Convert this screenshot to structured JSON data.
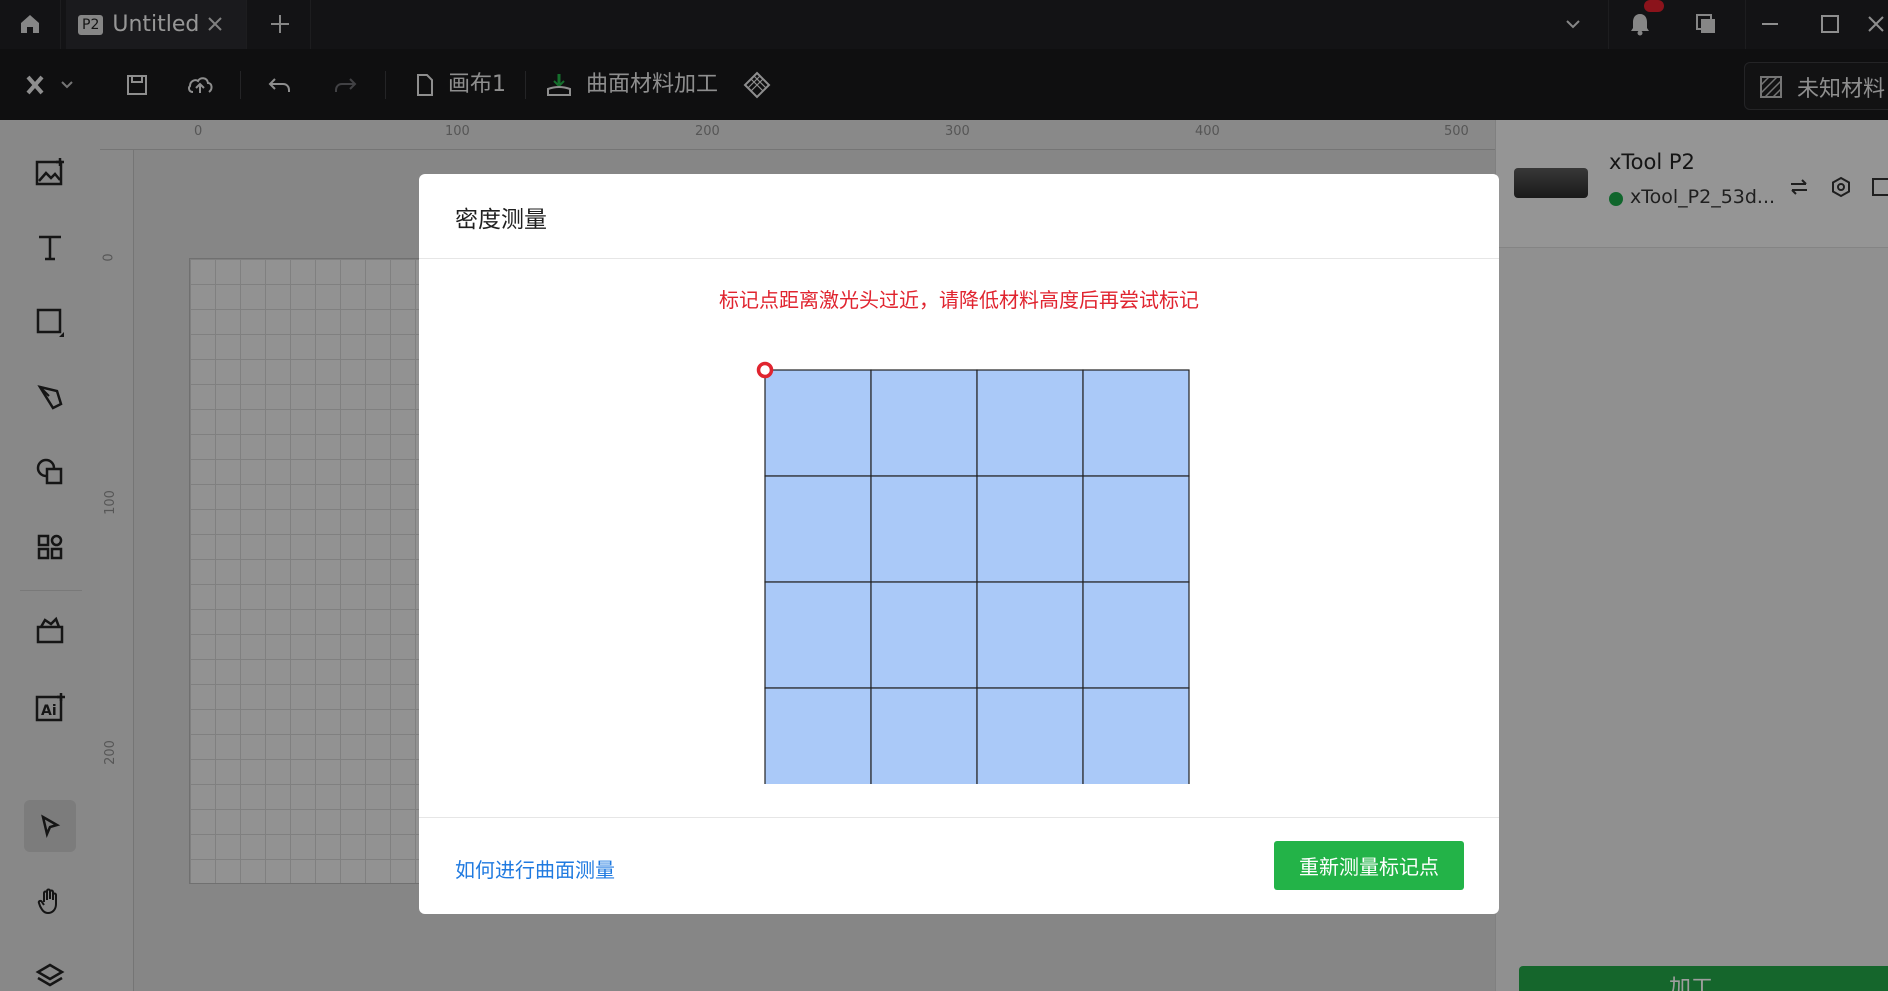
{
  "titlebar": {
    "tab_badge": "P2",
    "tab_title": "Untitled"
  },
  "toolbar": {
    "canvas_label": "画布1",
    "mode_label": "曲面材料加工",
    "material_label": "未知材料"
  },
  "ruler": {
    "h_labels": [
      "0",
      "100",
      "200",
      "300",
      "400",
      "500"
    ],
    "v_labels": [
      "0",
      "100",
      "200"
    ]
  },
  "device": {
    "name": "xTool P2",
    "id": "xTool_P2_53d...",
    "status_color": "#1aa548"
  },
  "process_button": {
    "label": "加工"
  },
  "dialog": {
    "title": "密度测量",
    "warning": "标记点距离激光头过近，请降低材料高度后再尝试标记",
    "help_link": "如何进行曲面测量",
    "primary_button": "重新测量标记点",
    "grid": {
      "rows": 4,
      "cols": 4,
      "fill": "#aac9f8",
      "marker_color": "#e0242f"
    }
  },
  "colors": {
    "accent_green": "#23b348",
    "link_blue": "#1f7ae0",
    "warning_red": "#e0242f"
  }
}
